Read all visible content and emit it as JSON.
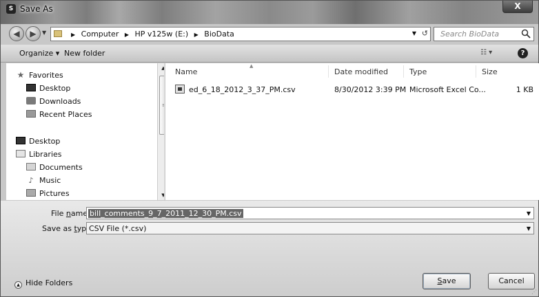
{
  "window": {
    "title": "Save As",
    "close_label": "X",
    "app_icon_glyph": "S"
  },
  "address_bar": {
    "crumbs": [
      "Computer",
      "HP v125w (E:)",
      "BioData"
    ],
    "separator": "▶",
    "dropdown_glyph": "▼",
    "refresh_glyph": "↺"
  },
  "search": {
    "placeholder": "Search BioData"
  },
  "toolbar": {
    "organize_label": "Organize ▾",
    "new_folder_label": "New folder",
    "views_label": "☷ ▾",
    "help_label": "?"
  },
  "nav_pane": {
    "items": [
      {
        "label": "Favorites",
        "icon": "star-icon"
      },
      {
        "label": "Desktop",
        "icon": "desktop-icon"
      },
      {
        "label": "Downloads",
        "icon": "downloads-icon"
      },
      {
        "label": "Recent Places",
        "icon": "recent-places-icon"
      },
      {
        "label": "Desktop",
        "icon": "desktop-icon"
      },
      {
        "label": "Libraries",
        "icon": "libraries-icon"
      },
      {
        "label": "Documents",
        "icon": "documents-icon"
      },
      {
        "label": "Music",
        "icon": "music-icon"
      },
      {
        "label": "Pictures",
        "icon": "pictures-icon"
      }
    ]
  },
  "file_list": {
    "columns": {
      "name": "Name",
      "date_modified": "Date modified",
      "type": "Type",
      "size": "Size"
    },
    "rows": [
      {
        "name": "ed_6_18_2012_3_37_PM.csv",
        "date_modified": "8/30/2012 3:39 PM",
        "type": "Microsoft Excel Co...",
        "size": "1 KB"
      }
    ]
  },
  "form": {
    "file_name_label_pre": "File ",
    "file_name_label_u": "n",
    "file_name_label_post": "ame:",
    "file_name_value": "bill_comments_9_7_2011_12_30_PM.csv",
    "save_type_label_pre": "Save as ",
    "save_type_label_u": "t",
    "save_type_label_post": "ype:",
    "save_type_value": "CSV File (*.csv)"
  },
  "footer": {
    "hide_folders_label": "Hide Folders",
    "save_label_u": "S",
    "save_label_rest": "ave",
    "cancel_label": "Cancel"
  }
}
